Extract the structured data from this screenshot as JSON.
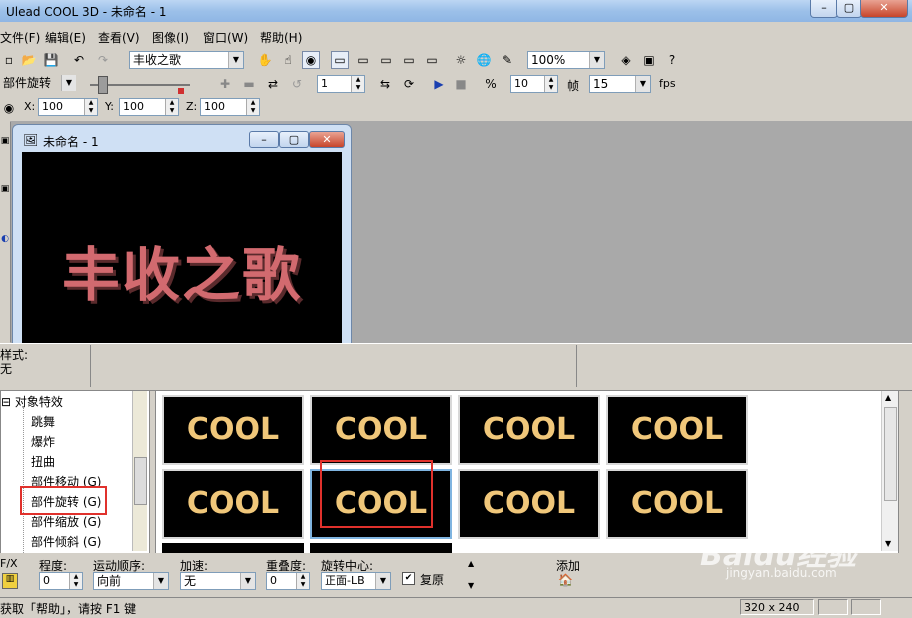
{
  "window": {
    "title": "Ulead COOL 3D - 未命名 - 1"
  },
  "menu": [
    "文件(F)",
    "编辑(E)",
    "查看(V)",
    "图像(I)",
    "窗口(W)",
    "帮助(H)"
  ],
  "toolbar": {
    "text_combo": "丰收之歌",
    "zoom_combo": "100%"
  },
  "animbar": {
    "mode_combo": "部件旋转",
    "frame_value": "1",
    "total_frames": "10",
    "frames_label": "帧",
    "fps_value": "15",
    "fps_label": "fps"
  },
  "position": {
    "x_label": "X:",
    "x_value": "100",
    "y_label": "Y:",
    "y_value": "100",
    "z_label": "Z:",
    "z_value": "100"
  },
  "document": {
    "title": "未命名 - 1",
    "text": "丰收之歌"
  },
  "style_panel": {
    "label": "样式:",
    "value": "无"
  },
  "tree": {
    "root": "对象特效",
    "items": [
      "跳舞",
      "爆炸",
      "扭曲",
      "部件移动 (G)",
      "部件旋转 (G)",
      "部件缩放 (G)",
      "部件倾斜 (G)"
    ]
  },
  "thumbnails": {
    "label": "COOL",
    "count": 8,
    "selected_index": 5
  },
  "params": {
    "fx_label": "F/X",
    "degree_label": "程度:",
    "degree_value": "0",
    "order_label": "运动顺序:",
    "order_value": "向前",
    "speed_label": "加速:",
    "speed_value": "无",
    "overlap_label": "重叠度:",
    "overlap_value": "0",
    "center_label": "旋转中心:",
    "center_value": "正面-LB",
    "restore_label": "复原",
    "add_label": "添加"
  },
  "status": {
    "help_text": "获取「帮助」，请按 F1 键",
    "size": "320 x 240"
  },
  "watermark": {
    "brand": "Baidu经验",
    "url": "jingyan.baidu.com"
  },
  "colors": {
    "highlight_box": "#e0312c",
    "thumb_text": "#f0c77a",
    "headline_text": "#d26a6f"
  }
}
